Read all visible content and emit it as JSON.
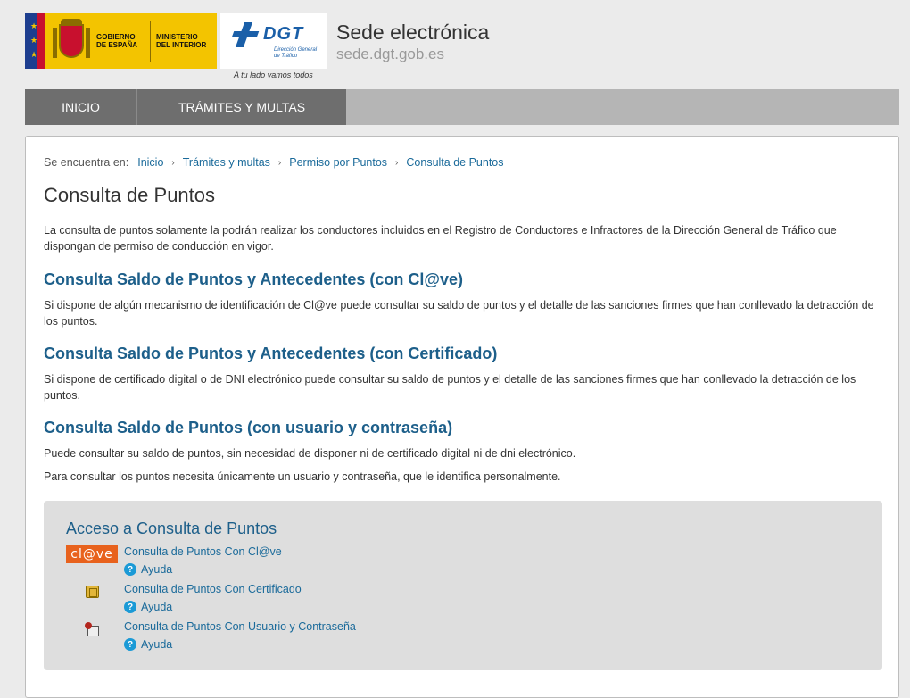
{
  "header": {
    "gov_logo_line1": "GOBIERNO",
    "gov_logo_line2": "DE ESPAÑA",
    "ministry_line1": "MINISTERIO",
    "ministry_line2": "DEL INTERIOR",
    "dgt_name": "DGT",
    "dgt_sub": "Dirección General de Tráfico",
    "tagline": "A tu lado vamos todos",
    "site_title": "Sede electrónica",
    "site_url": "sede.dgt.gob.es"
  },
  "nav": {
    "items": [
      {
        "label": "INICIO"
      },
      {
        "label": "TRÁMITES Y MULTAS"
      }
    ]
  },
  "breadcrumb": {
    "label": "Se encuentra en:",
    "items": [
      "Inicio",
      "Trámites y multas",
      "Permiso por Puntos",
      "Consulta de Puntos"
    ]
  },
  "main": {
    "title": "Consulta de Puntos",
    "intro": "La consulta de puntos solamente la podrán realizar los conductores incluidos en el Registro de Conductores e Infractores de la Dirección General de Tráfico que dispongan de permiso de conducción en vigor.",
    "sections": [
      {
        "title": "Consulta Saldo de Puntos y Antecedentes (con Cl@ve)",
        "text": "Si dispone de algún mecanismo de identificación de Cl@ve puede consultar su saldo de puntos y el detalle de las sanciones firmes que han conllevado la detracción de los puntos."
      },
      {
        "title": "Consulta Saldo de Puntos y Antecedentes (con Certificado)",
        "text": "Si dispone de certificado digital o de DNI electrónico puede consultar su saldo de puntos y el detalle de las sanciones firmes que han conllevado la detracción de los puntos."
      },
      {
        "title": "Consulta Saldo de Puntos (con usuario y contraseña)",
        "text": "Puede consultar su saldo de puntos, sin necesidad de disponer ni de certificado digital ni de dni electrónico.",
        "text2": "Para consultar los puntos necesita únicamente un usuario y contraseña, que le identifica personalmente."
      }
    ]
  },
  "access": {
    "title": "Acceso a Consulta de Puntos",
    "clave_badge": "cl@ve",
    "help_label": "Ayuda",
    "items": [
      {
        "label": "Consulta de Puntos Con Cl@ve",
        "icon": "clave-logo-icon"
      },
      {
        "label": "Consulta de Puntos Con Certificado",
        "icon": "chip-card-icon"
      },
      {
        "label": "Consulta de Puntos Con Usuario y Contraseña",
        "icon": "keypad-icon"
      }
    ]
  },
  "colors": {
    "link": "#1a6a9a",
    "section_title": "#1d5f8a",
    "nav_active": "#6e6e6e",
    "nav_bar": "#b5b5b5",
    "clave_orange": "#e8621d",
    "help_blue": "#1b9ad6"
  }
}
